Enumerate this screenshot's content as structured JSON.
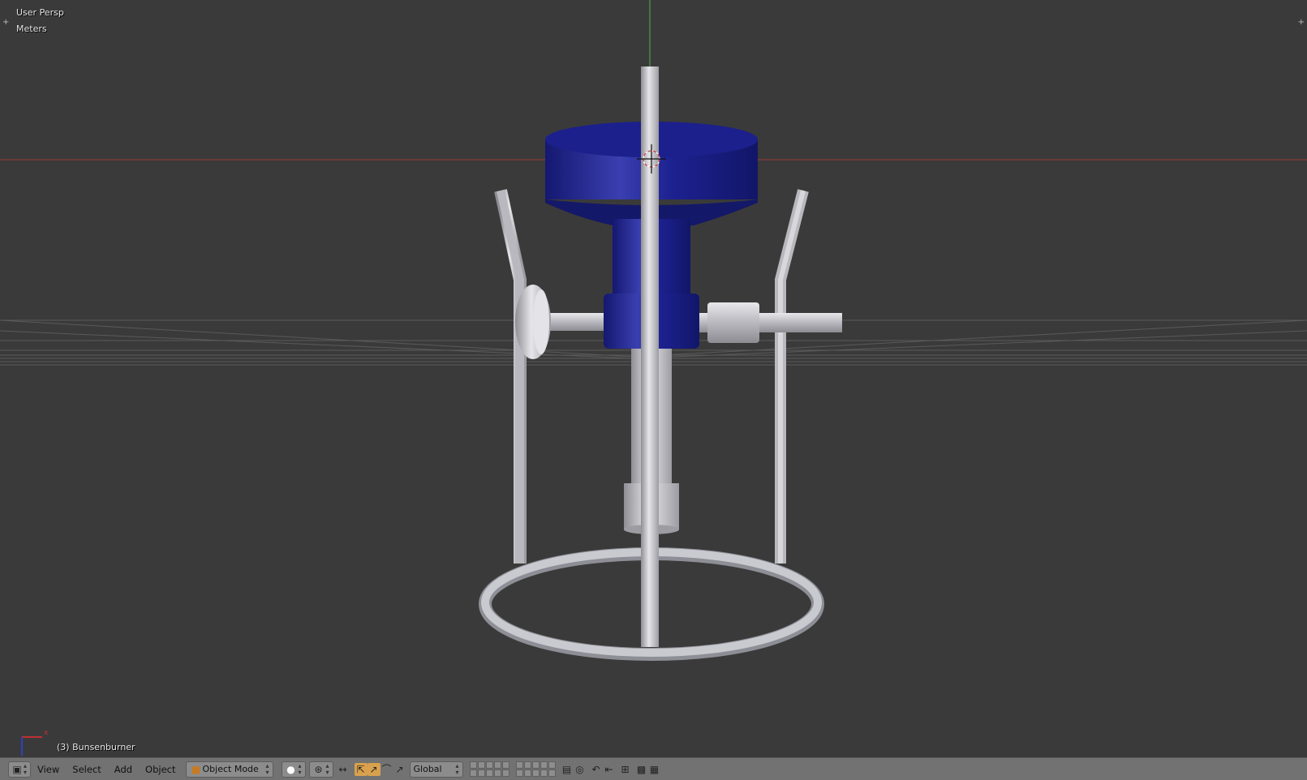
{
  "viewport": {
    "view_name": "User Persp",
    "units": "Meters",
    "object_info": "(3) Bunsenburner"
  },
  "header": {
    "menus": [
      "View",
      "Select",
      "Add",
      "Object"
    ],
    "mode": "Object Mode",
    "transform_orientation": "Global"
  },
  "colors": {
    "background": "#3a3a3a",
    "grid": "#4a4a4a",
    "x_axis": "#9b3b3b",
    "y_axis": "#4caf50",
    "object_blue": "#1a1f8c",
    "metal": "#c8c8cc",
    "header": "#727272",
    "active_toggle": "#d9a14e"
  },
  "icons": {
    "editor_type": "cube-icon",
    "viewport_shading": "solid-sphere-icon",
    "pivot": "pivot-icon",
    "manipulator": "manipulator-icon",
    "translate": "translate-icon",
    "rotate": "rotate-icon",
    "scale": "scale-icon",
    "lock_camera": "layer-icon",
    "proportional": "proportional-edit-icon",
    "snap": "snap-magnet-icon",
    "render": "render-camera-icon",
    "clapper": "render-anim-icon"
  }
}
